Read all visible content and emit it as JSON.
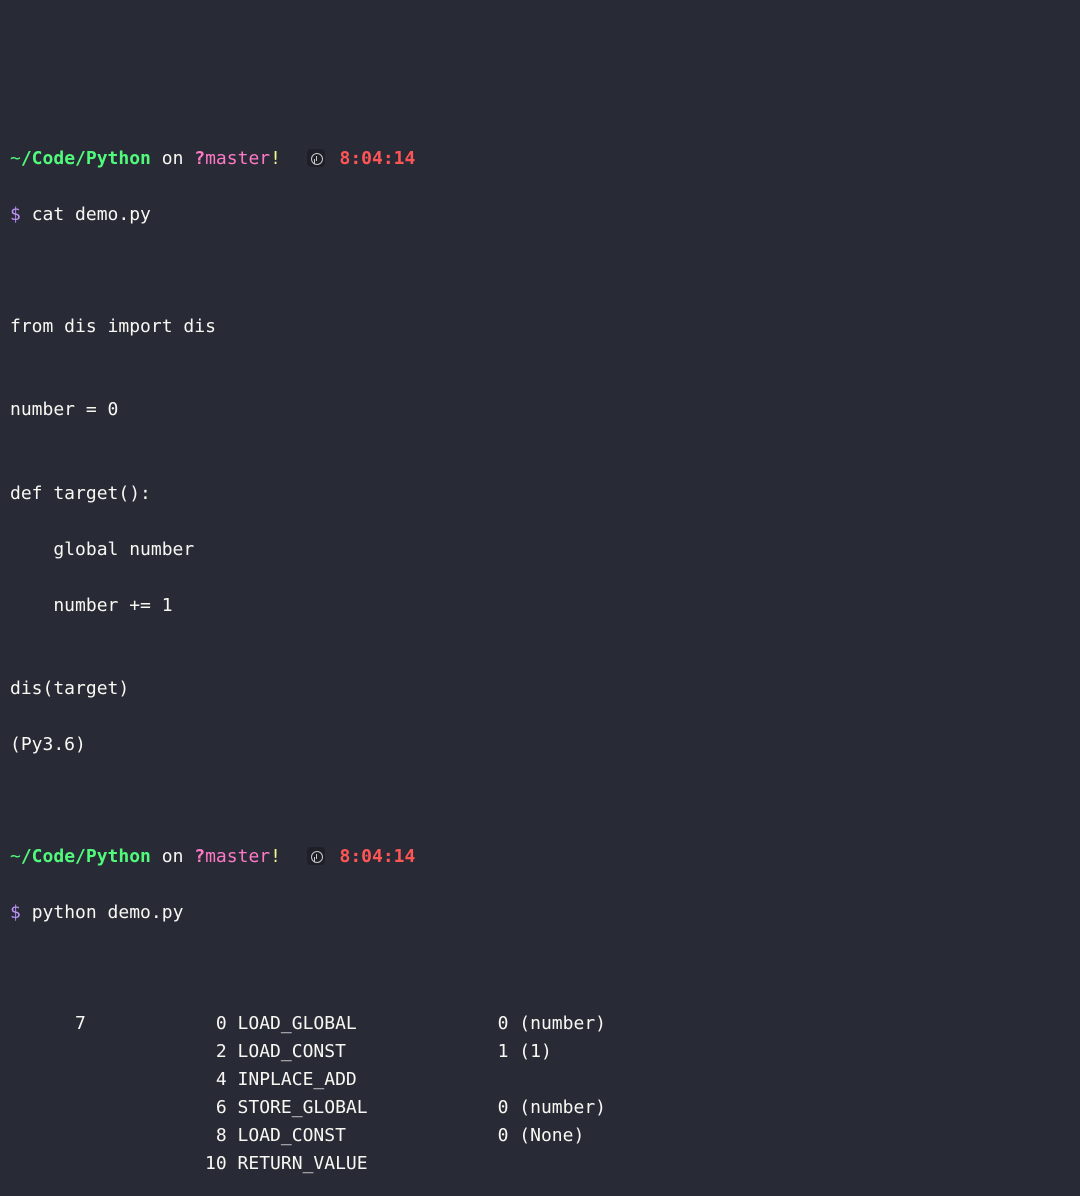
{
  "prompt1": {
    "tilde": "~",
    "path": "/Code/Python",
    "on": " on ",
    "branchQ": "?",
    "branch": "master",
    "bang": "!",
    "time": "8:04:14",
    "symbol": "$ ",
    "command": "cat demo.py"
  },
  "file": {
    "l1": "from dis import dis",
    "l2": "",
    "l3": "number = 0",
    "l4": "",
    "l5": "def target():",
    "l6": "    global number",
    "l7": "    number += 1",
    "l8": "",
    "l9": "dis(target)",
    "l10": "(Py3.6)"
  },
  "prompt2": {
    "tilde": "~",
    "path": "/Code/Python",
    "on": " on ",
    "branchQ": "?",
    "branch": "master",
    "bang": "!",
    "time": "8:04:14",
    "symbol": "$ ",
    "command": "python demo.py"
  },
  "dis": {
    "rows": [
      {
        "line": "7",
        "off": "0",
        "op": "LOAD_GLOBAL",
        "arg": "0",
        "argr": "(number)"
      },
      {
        "line": "",
        "off": "2",
        "op": "LOAD_CONST",
        "arg": "1",
        "argr": "(1)"
      },
      {
        "line": "",
        "off": "4",
        "op": "INPLACE_ADD",
        "arg": "",
        "argr": ""
      },
      {
        "line": "",
        "off": "6",
        "op": "STORE_GLOBAL",
        "arg": "0",
        "argr": "(number)"
      },
      {
        "line": "",
        "off": "8",
        "op": "LOAD_CONST",
        "arg": "0",
        "argr": "(None)"
      },
      {
        "line": "",
        "off": "10",
        "op": "RETURN_VALUE",
        "arg": "",
        "argr": ""
      }
    ]
  }
}
